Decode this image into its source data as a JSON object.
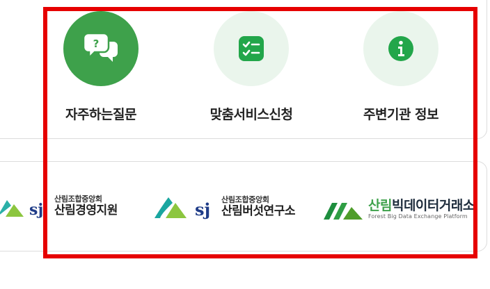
{
  "colors": {
    "primary_green": "#3ea14b",
    "light_green_bg": "#eaf5ec",
    "icon_green": "#22a64a",
    "highlight_red": "#e60000"
  },
  "quick_menu": [
    {
      "label": "자주하는질문",
      "icon": "faq-chat-icon"
    },
    {
      "label": "맞춤서비스신청",
      "icon": "checklist-icon"
    },
    {
      "label": "주변기관 정보",
      "icon": "info-icon"
    }
  ],
  "partners": [
    {
      "org_small": "산림조합중앙회",
      "org_big": "산림경영지원"
    },
    {
      "org_small": "산림조합중앙회",
      "org_big": "산림버섯연구소"
    },
    {
      "title_a": "산림",
      "title_b": "빅데이터거래소",
      "subtitle": "Forest Big Data Exchange Platform"
    }
  ]
}
